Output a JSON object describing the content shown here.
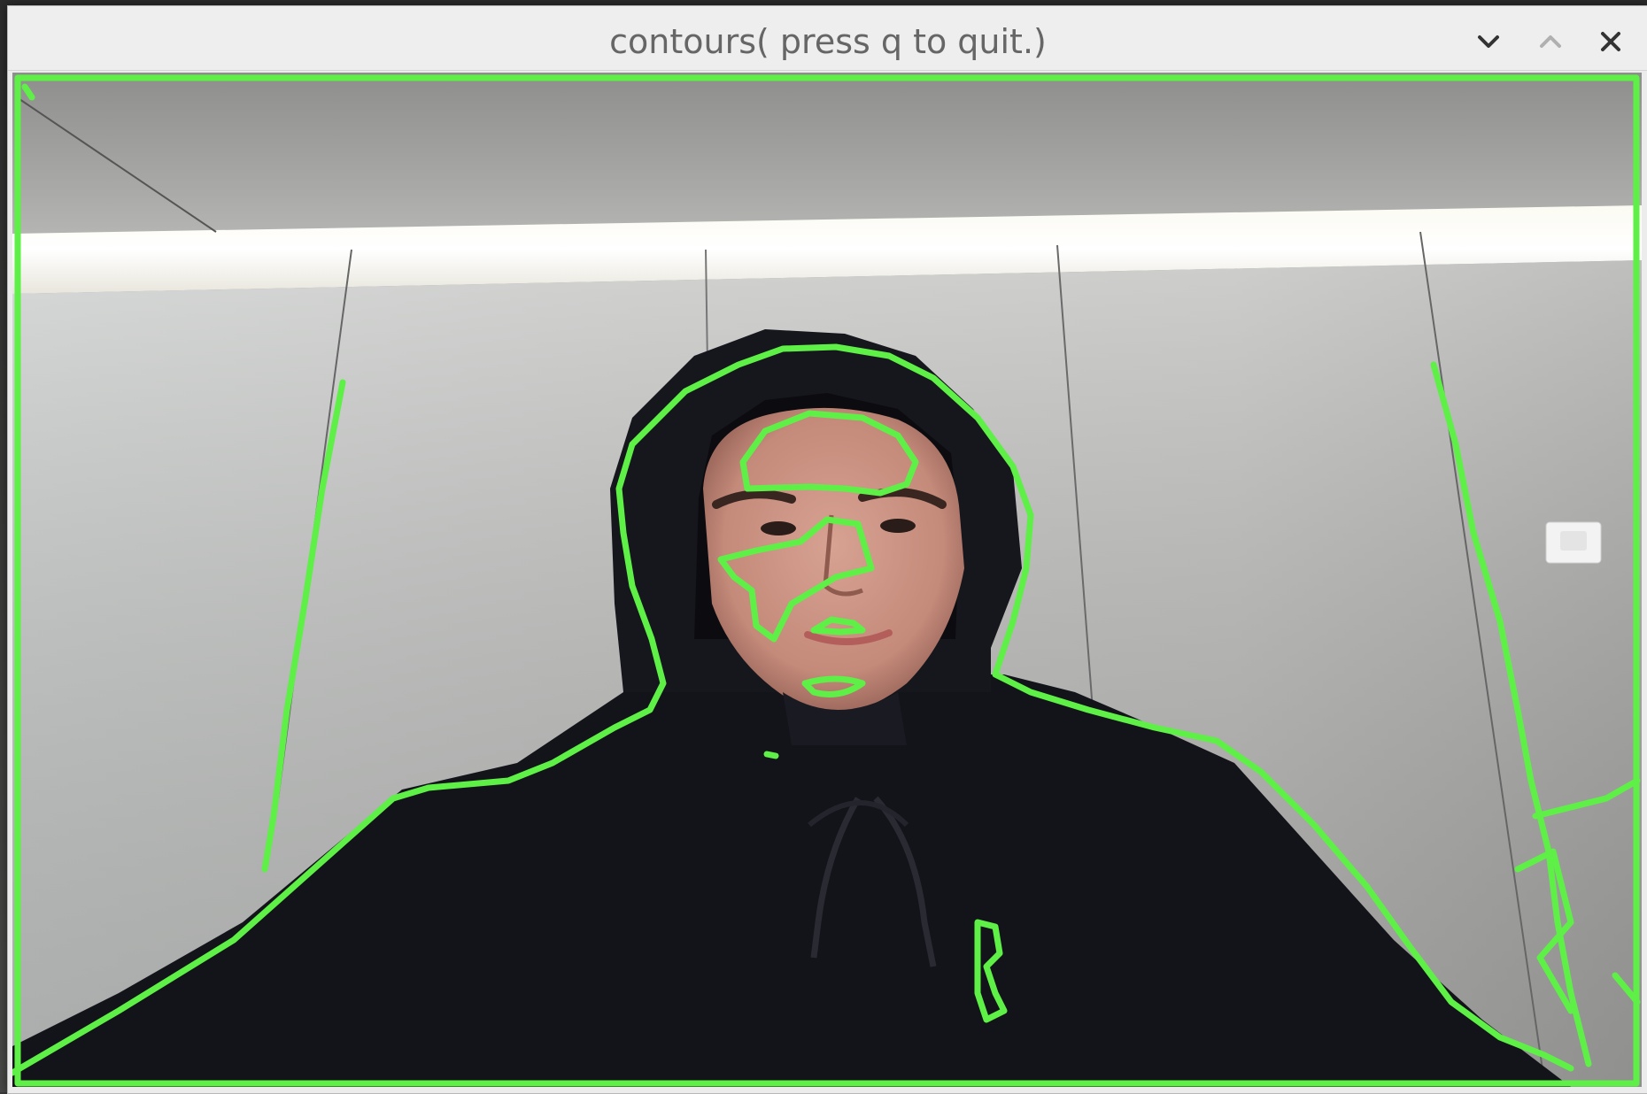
{
  "window": {
    "title": "contours( press q to quit.)",
    "buttons": {
      "minimize": "chevron-down-icon",
      "maximize": "chevron-up-icon",
      "close": "close-icon"
    }
  },
  "frame": {
    "content": "camera-feed",
    "contour_color": "#5ef047"
  }
}
